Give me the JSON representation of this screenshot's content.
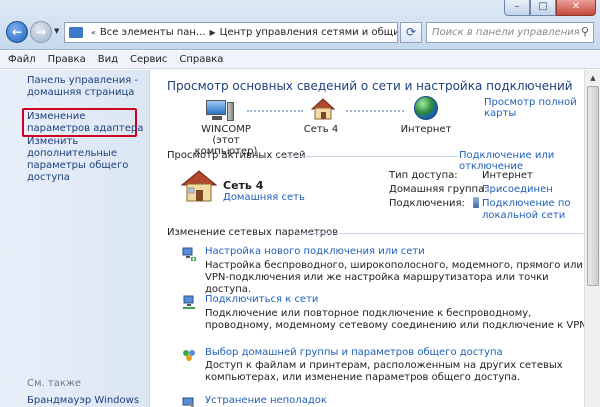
{
  "window": {
    "address_parts": [
      "Все элементы пан...",
      "Центр управления сетями и общим доступом"
    ],
    "search_placeholder": "Поиск в панели управления",
    "controls": {
      "minimize": "–",
      "maximize": "□",
      "close": "✕"
    }
  },
  "menu": [
    "Файл",
    "Правка",
    "Вид",
    "Сервис",
    "Справка"
  ],
  "sidebar": {
    "home": "Панель управления - домашняя страница",
    "adapter": "Изменение параметров адаптера",
    "sharing": "Изменить дополнительные параметры общего доступа",
    "see_also": "См. также",
    "firewall": "Брандмауэр Windows"
  },
  "main": {
    "title": "Просмотр основных сведений о сети и настройка подключений",
    "full_map": "Просмотр полной карты",
    "map": {
      "computer": "WINCOMP",
      "computer_sub": "(этот компьютер)",
      "network": "Сеть 4",
      "internet": "Интернет"
    },
    "active_head": "Просмотр активных сетей",
    "connect_link": "Подключение или отключение",
    "active_network": {
      "name": "Сеть 4",
      "type": "Домашняя сеть",
      "access_label": "Тип доступа:",
      "access_value": "Интернет",
      "homegroup_label": "Домашняя группа:",
      "homegroup_value": "Присоединен",
      "connections_label": "Подключения:",
      "connection_line1": "Подключение по",
      "connection_line2": "локальной сети"
    },
    "change_head": "Изменение сетевых параметров",
    "tasks": [
      {
        "title": "Настройка нового подключения или сети",
        "desc": "Настройка беспроводного, широкополосного, модемного, прямого или VPN-подключения или же настройка маршрутизатора или точки доступа."
      },
      {
        "title": "Подключиться к сети",
        "desc": "Подключение или повторное подключение к беспроводному, проводному, модемному сетевому соединению или подключение к VPN."
      },
      {
        "title": "Выбор домашней группы и параметров общего доступа",
        "desc": "Доступ к файлам и принтерам, расположенным на других сетевых компьютерах, или изменение параметров общего доступа."
      },
      {
        "title": "Устранение неполадок",
        "desc": ""
      }
    ]
  },
  "colors": {
    "link": "#1f5fb8",
    "highlight": "#d0001f"
  }
}
